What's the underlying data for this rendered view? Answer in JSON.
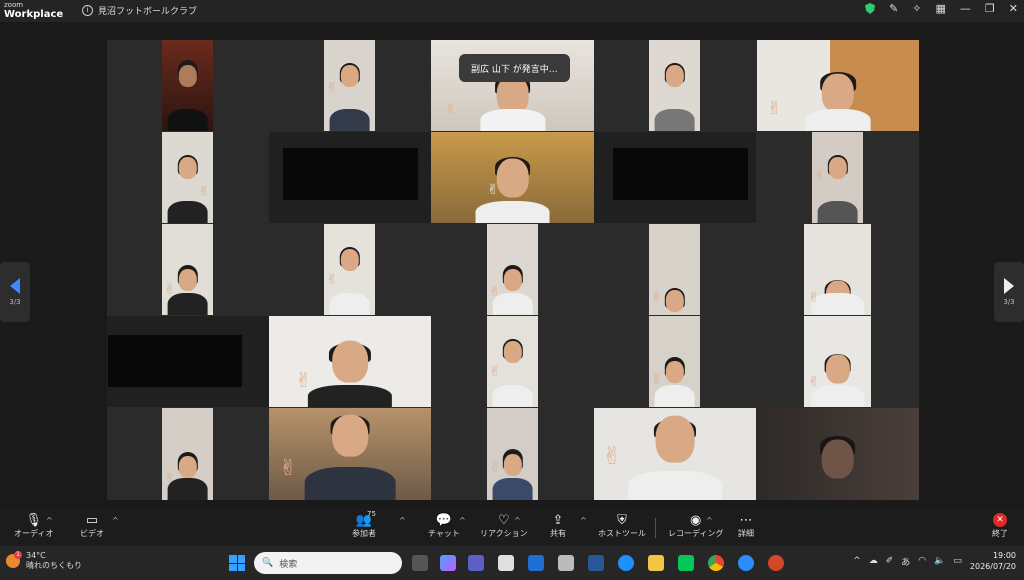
{
  "app": {
    "logo_small": "zoom",
    "logo_big": "Workplace",
    "meeting_title": "見沼フットボールクラブ"
  },
  "notice": "副広 山下 が発言中…",
  "pager": {
    "left_label": "3/3",
    "right_label": "3/3"
  },
  "toolbar": {
    "audio": "オーディオ",
    "video": "ビデオ",
    "participants": "参加者",
    "participants_count": "75",
    "chat": "チャット",
    "reactions": "リアクション",
    "share": "共有",
    "host_tools": "ホストツール",
    "recording": "レコーディング",
    "more": "詳細",
    "end": "終了"
  },
  "taskbar": {
    "temperature": "34°C",
    "weather_text": "晴れのちくもり",
    "weather_badge": "1",
    "search_placeholder": "検索",
    "ime_mode": "あ",
    "time": "19:00",
    "date": "2026/07/20"
  },
  "colors": {
    "shield_green": "#2ecc71",
    "pager_arrow_blue": "#3d8bff",
    "end_red": "#e02828"
  }
}
